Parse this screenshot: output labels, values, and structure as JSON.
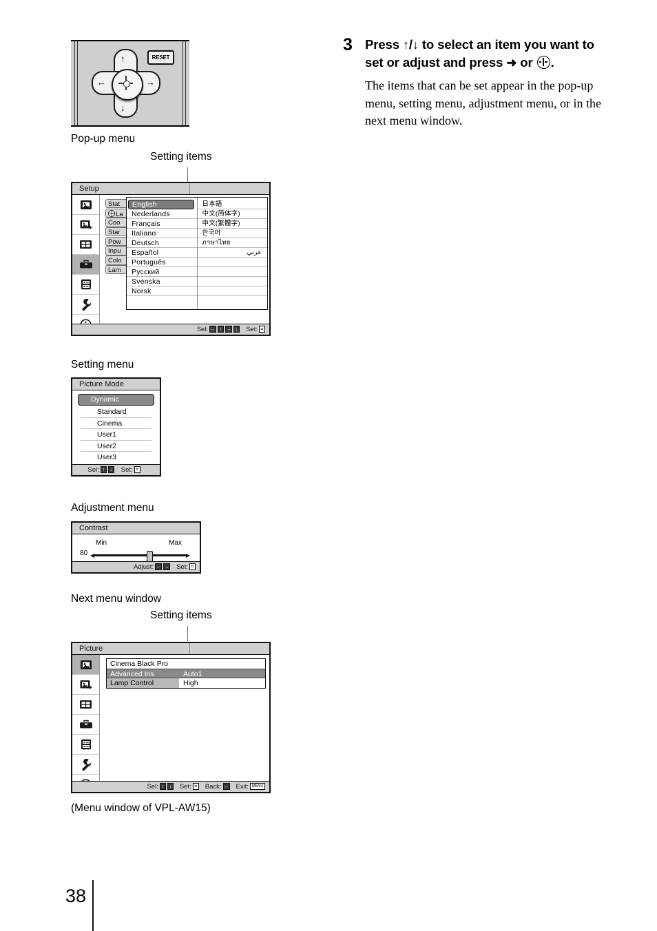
{
  "page": {
    "number": "38"
  },
  "step": {
    "number": "3",
    "title_part1": "Press ",
    "title_arrow_up": "↑",
    "title_slash": "/",
    "title_arrow_down": "↓",
    "title_part2": " to select an item you want to set or adjust and press ",
    "title_arrow_right": "➜",
    "title_or": " or ",
    "title_period": ".",
    "body": "The items that can be set appear in the pop-up menu, setting menu, adjustment menu, or in the next menu window."
  },
  "remote": {
    "reset_label": "RESET",
    "arrow_up": "↑",
    "arrow_down": "↓",
    "arrow_left": "←",
    "arrow_right": "→"
  },
  "captions": {
    "popup_menu": "Pop-up menu",
    "setting_items_1": "Setting items",
    "setting_menu": "Setting menu",
    "adjustment_menu": "Adjustment menu",
    "next_menu_window": "Next menu window",
    "setting_items_2": "Setting items",
    "menu_window_note": "(Menu window of VPL-AW15)"
  },
  "popup_menu": {
    "title": "Setup",
    "setup_items": [
      {
        "label": "Stat",
        "icon": ""
      },
      {
        "label": "La",
        "icon": "globe-icon"
      },
      {
        "label": "Coo",
        "icon": ""
      },
      {
        "label": "Star",
        "icon": ""
      },
      {
        "label": "Pow",
        "icon": ""
      },
      {
        "label": "Inpu",
        "icon": ""
      },
      {
        "label": "Colo",
        "icon": ""
      },
      {
        "label": "Lam",
        "icon": ""
      }
    ],
    "languages_left": [
      "English",
      "Nederlands",
      "Français",
      "Italiano",
      "Deutsch",
      "Español",
      "Português",
      "Русский",
      "Svenska",
      "Norsk"
    ],
    "languages_left_selected": "English",
    "languages_right": [
      "日本語",
      "中文(简体字)",
      "中文(繁體字)",
      "한국어",
      "ภาษาไทย",
      "عربي"
    ],
    "footer": {
      "sel_label": "Sel:",
      "sel_keys": [
        "←",
        "↑",
        "→",
        "↓"
      ],
      "set_label": "Set:",
      "set_key": "⌗"
    }
  },
  "setting_menu": {
    "title": "Picture Mode",
    "items": [
      "Dynamic",
      "Standard",
      "Cinema",
      "User1",
      "User2",
      "User3"
    ],
    "selected": "Dynamic",
    "footer": {
      "sel_label": "Sel:",
      "sel_keys": [
        "↑",
        "↓"
      ],
      "set_label": "Set:",
      "set_key": "⌗"
    }
  },
  "adjustment_menu": {
    "title": "Contrast",
    "min_label": "Min",
    "max_label": "Max",
    "value": "80",
    "footer": {
      "adjust_label": "Adjust:",
      "adjust_keys": [
        "←",
        "→"
      ],
      "set_label": "Set:",
      "set_key": "⌗"
    }
  },
  "next_menu": {
    "title": "Picture",
    "rows": [
      {
        "label": "Cinema Black Pro",
        "value": "",
        "state": "head"
      },
      {
        "label": "Advanced Iris",
        "value": "Auto1",
        "state": "selected"
      },
      {
        "label": "Lamp Control",
        "value": "High",
        "state": "normal"
      }
    ],
    "footer": {
      "sel_label": "Sel:",
      "sel_keys": [
        "↑",
        "↓"
      ],
      "set_label": "Set:",
      "set_key": "⌗",
      "back_label": "Back:",
      "back_key": "←",
      "exit_label": "Exit:",
      "exit_key": "MENU"
    }
  },
  "colors": {
    "osd_header": "#d0d0d0",
    "highlight": "#7d7d7d",
    "remote_body": "#cfcfcf",
    "outline": "#111111"
  }
}
